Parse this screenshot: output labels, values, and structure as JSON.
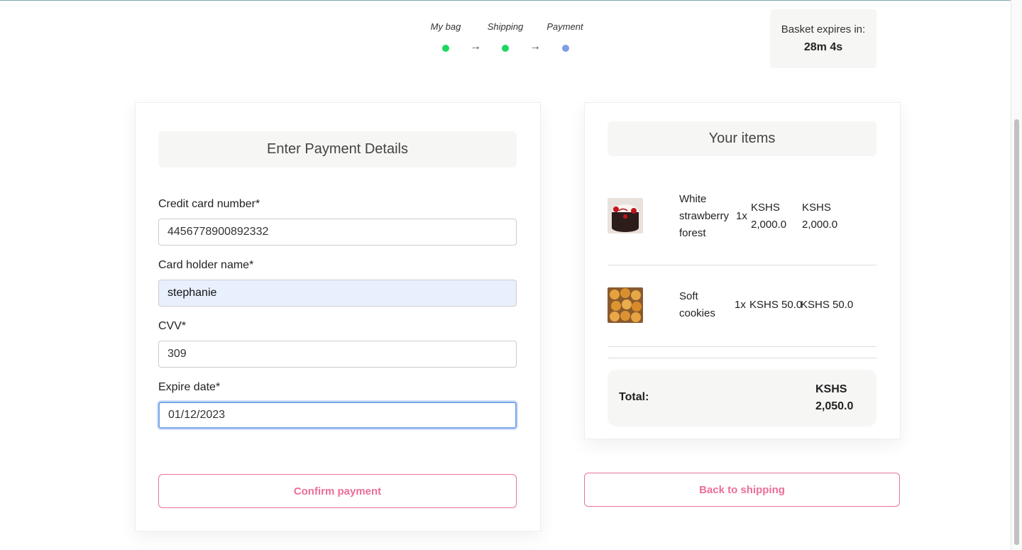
{
  "stepper": {
    "steps": [
      {
        "label": "My bag",
        "status_color": "#1ed760"
      },
      {
        "label": "Shipping",
        "status_color": "#1ed760"
      },
      {
        "label": "Payment",
        "status_color": "#7f9ee6"
      }
    ],
    "arrow": "→"
  },
  "basket": {
    "expires_label": "Basket expires in:",
    "expires_value": "28m 4s"
  },
  "payment": {
    "heading": "Enter Payment Details",
    "fields": {
      "card_number": {
        "label": "Credit card number*",
        "value": "4456778900892332"
      },
      "holder_name": {
        "label": "Card holder name*",
        "value": "stephanie"
      },
      "cvv": {
        "label": "CVV*",
        "value": "309"
      },
      "expire_date": {
        "label": "Expire date*",
        "value": "01/12/2023"
      }
    },
    "confirm_label": "Confirm payment"
  },
  "items": {
    "heading": "Your items",
    "list": [
      {
        "name_lines": [
          "White",
          "strawberry",
          "forest"
        ],
        "qty": "1x",
        "price_lines": [
          "KSHS",
          "2,000.0"
        ],
        "total_lines": [
          "KSHS",
          "2,000.0"
        ],
        "thumb_icon": "cake-thumbnail"
      },
      {
        "name_lines": [
          "Soft",
          "cookies"
        ],
        "qty": "1x",
        "price": "KSHS 50.0",
        "total": "KSHS 50.0",
        "thumb_icon": "cookies-thumbnail"
      }
    ],
    "total_label": "Total:",
    "total_value_lines": [
      "KSHS",
      "2,050.0"
    ]
  },
  "back_label": "Back to shipping",
  "colors": {
    "accent": "#ec6e98",
    "step_done": "#1ed760",
    "step_current": "#7f9ee6"
  }
}
